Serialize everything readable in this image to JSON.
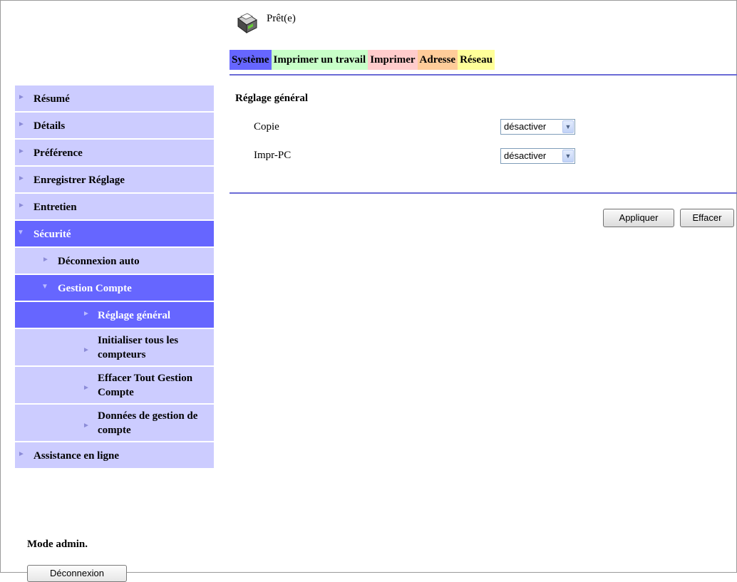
{
  "header": {
    "status": "Prêt(e)",
    "status_icon": "printer-icon"
  },
  "tabs": [
    {
      "label": "Système",
      "color": "#6666ff",
      "text_color": "#000000",
      "active": true
    },
    {
      "label": "Imprimer un travail",
      "color": "#c8ffc8",
      "text_color": "#000000"
    },
    {
      "label": "Imprimer",
      "color": "#ffcccc",
      "text_color": "#000000"
    },
    {
      "label": "Adresse",
      "color": "#ffcc99",
      "text_color": "#000000"
    },
    {
      "label": "Réseau",
      "color": "#ffff99",
      "text_color": "#000000"
    }
  ],
  "sidebar": {
    "items": [
      {
        "label": "Résumé"
      },
      {
        "label": "Détails"
      },
      {
        "label": "Préférence"
      },
      {
        "label": "Enregistrer Réglage"
      },
      {
        "label": "Entretien"
      },
      {
        "label": "Sécurité",
        "expanded": true
      },
      {
        "label": "Déconnexion auto"
      },
      {
        "label": "Gestion Compte",
        "expanded": true
      },
      {
        "label": "Réglage général",
        "selected": true
      },
      {
        "label": "Initialiser tous les compteurs"
      },
      {
        "label": "Effacer Tout Gestion Compte"
      },
      {
        "label": "Données de gestion de compte"
      },
      {
        "label": "Assistance en ligne"
      }
    ]
  },
  "admin": {
    "mode_label": "Mode admin.",
    "logout_label": "Déconnexion"
  },
  "main": {
    "section_title": "Réglage général",
    "fields": [
      {
        "label": "Copie",
        "value": "désactiver"
      },
      {
        "label": "Impr-PC",
        "value": "désactiver"
      }
    ],
    "apply_label": "Appliquer",
    "clear_label": "Effacer"
  },
  "colors": {
    "accent": "#6666ff",
    "nav_bg": "#ccccff",
    "divider": "#6b6bd6"
  }
}
